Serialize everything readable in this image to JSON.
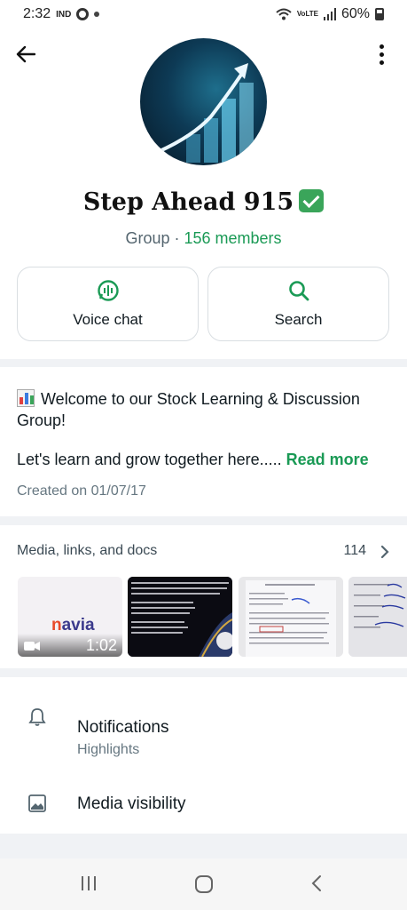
{
  "status_bar": {
    "time": "2:32",
    "carrier": "IND",
    "battery": "60%",
    "network": "VoLTE"
  },
  "header": {
    "back_icon": "arrow-left-icon",
    "more_icon": "more-vertical-icon"
  },
  "group": {
    "name": "Step Ahead 915",
    "type": "Group",
    "separator": " · ",
    "members": "156 members"
  },
  "actions": {
    "voice_chat": "Voice chat",
    "search": "Search"
  },
  "description": {
    "title": "Welcome to our Stock Learning & Discussion Group!",
    "body": "Let's learn and grow together here.....",
    "read_more": "Read more",
    "created": "Created on 01/07/17"
  },
  "media": {
    "header": "Media, links, and docs",
    "count": "114",
    "items": [
      {
        "kind": "video",
        "duration": "1:02",
        "logo": "navia"
      },
      {
        "kind": "image"
      },
      {
        "kind": "image"
      },
      {
        "kind": "image"
      }
    ]
  },
  "settings": {
    "notifications_title": "Notifications",
    "notifications_sub": "Highlights",
    "media_visibility": "Media visibility"
  },
  "colors": {
    "accent": "#1a9a55",
    "text": "#111b21",
    "muted": "#667781"
  }
}
